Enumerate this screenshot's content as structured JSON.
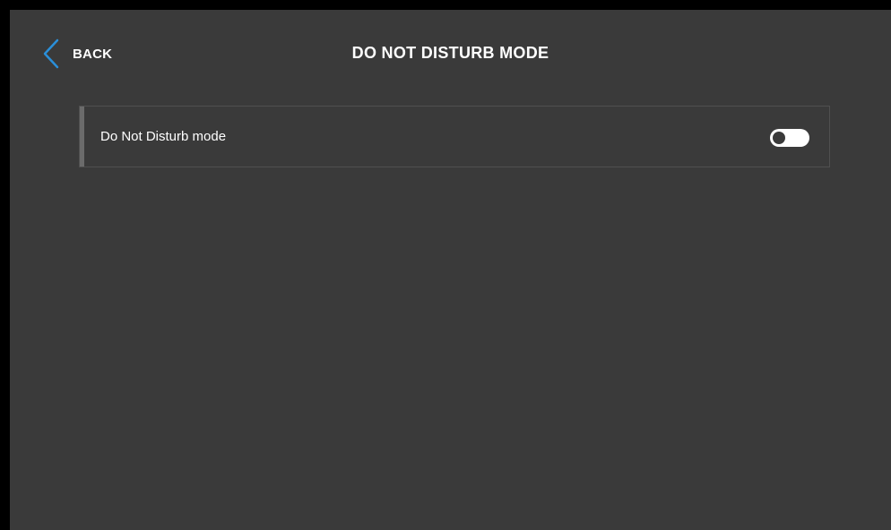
{
  "header": {
    "back_label": "BACK",
    "title": "DO NOT DISTURB MODE",
    "back_icon": "chevron-left-icon",
    "accent_color": "#2a8fd9"
  },
  "settings": [
    {
      "label": "Do Not Disturb mode",
      "toggle_on": false
    }
  ],
  "colors": {
    "background": "#3a3a3a",
    "text": "#ffffff"
  }
}
